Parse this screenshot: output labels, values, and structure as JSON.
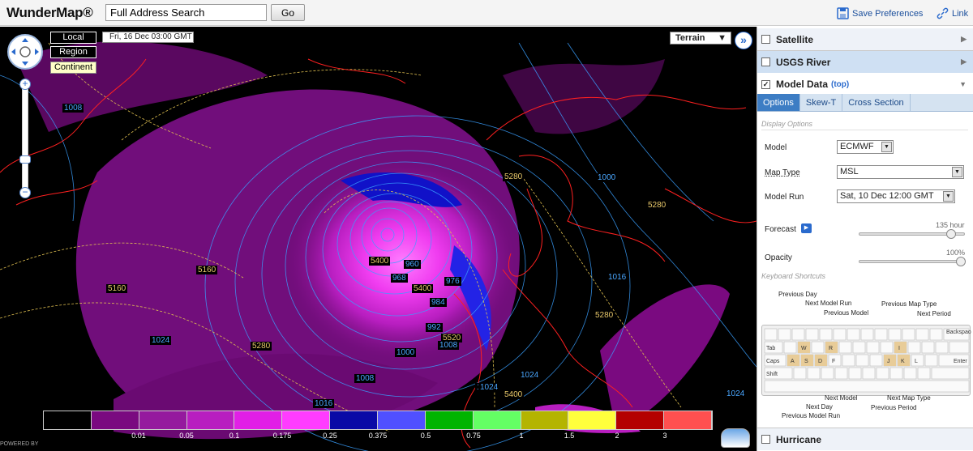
{
  "header": {
    "logo": "WunderMap®",
    "search_value": "Full Address Search",
    "go_label": "Go",
    "save_preferences": "Save Preferences",
    "link": "Link"
  },
  "map": {
    "scale_buttons": [
      "Local",
      "Region",
      "Continent"
    ],
    "timestamp": "Fri, 16 Dec 03:00 GMT",
    "map_type": "Terrain",
    "legend": {
      "colors": [
        "#000000",
        "#7a0a80",
        "#951a9e",
        "#b81ec0",
        "#e11fe6",
        "#ff3cff",
        "#0a0aa6",
        "#5050ff",
        "#00b400",
        "#64ff64",
        "#b4b400",
        "#ffff3c",
        "#b40000",
        "#ff5050"
      ],
      "labels": [
        "0.01",
        "0.05",
        "0.1",
        "0.175",
        "0.25",
        "0.375",
        "0.5",
        "0.75",
        "1",
        "1.5",
        "2",
        "3"
      ]
    },
    "contour_labels": [
      {
        "text": "1008",
        "color": "#4aa7ff"
      },
      {
        "text": "1000",
        "color": "#4aa7ff"
      },
      {
        "text": "1016",
        "color": "#4aa7ff"
      },
      {
        "text": "1024",
        "color": "#4aa7ff"
      },
      {
        "text": "1024",
        "color": "#4aa7ff"
      },
      {
        "text": "1024",
        "color": "#4aa7ff"
      },
      {
        "text": "1016",
        "color": "#4aa7ff"
      },
      {
        "text": "1008",
        "color": "#4aa7ff"
      },
      {
        "text": "1024",
        "color": "#4aa7ff"
      },
      {
        "text": "5160",
        "color": "#e8c86a"
      },
      {
        "text": "5160",
        "color": "#e8c86a"
      },
      {
        "text": "5280",
        "color": "#e8c86a"
      },
      {
        "text": "5280",
        "color": "#e8c86a"
      },
      {
        "text": "5280",
        "color": "#e8c86a"
      },
      {
        "text": "5280",
        "color": "#e8c86a"
      },
      {
        "text": "5400",
        "color": "#e8c86a"
      },
      {
        "text": "5400",
        "color": "#e8c86a"
      },
      {
        "text": "5400",
        "color": "#e8c86a"
      },
      {
        "text": "5520",
        "color": "#e8c86a"
      },
      {
        "text": "960",
        "color": "#4aa7ff"
      },
      {
        "text": "968",
        "color": "#4aa7ff"
      },
      {
        "text": "976",
        "color": "#4aa7ff"
      },
      {
        "text": "984",
        "color": "#4aa7ff"
      },
      {
        "text": "992",
        "color": "#4aa7ff"
      },
      {
        "text": "1000",
        "color": "#4aa7ff"
      },
      {
        "text": "1008",
        "color": "#4aa7ff"
      },
      {
        "text": "1024",
        "color": "#4aa7ff"
      }
    ],
    "powered_by": "POWERED BY"
  },
  "panel": {
    "layers": [
      {
        "label": "Satellite",
        "checked": false
      },
      {
        "label": "USGS River",
        "checked": false
      },
      {
        "label": "Model Data",
        "checked": true
      }
    ],
    "model_top_link": "(top)",
    "tabs": [
      "Options",
      "Skew-T",
      "Cross Section"
    ],
    "display_options_heading": "Display Options",
    "model_label": "Model",
    "model_value": "ECMWF",
    "map_type_label": "Map Type",
    "map_type_value": "MSL",
    "model_run_label": "Model Run",
    "model_run_value": "Sat, 10 Dec 12:00 GMT",
    "forecast_label": "Forecast",
    "forecast_value": "135 hour",
    "forecast_fraction": 0.9,
    "opacity_label": "Opacity",
    "opacity_value": "100%",
    "opacity_fraction": 1.0,
    "keyboard_heading": "Keyboard Shortcuts",
    "shortcuts": [
      "Previous Day",
      "Next Model Run",
      "Previous Model",
      "Previous Map Type",
      "Next Period",
      "Next Model",
      "Next Day",
      "Previous Model Run",
      "Next Map Type",
      "Previous Period"
    ],
    "hurricane": "Hurricane"
  }
}
